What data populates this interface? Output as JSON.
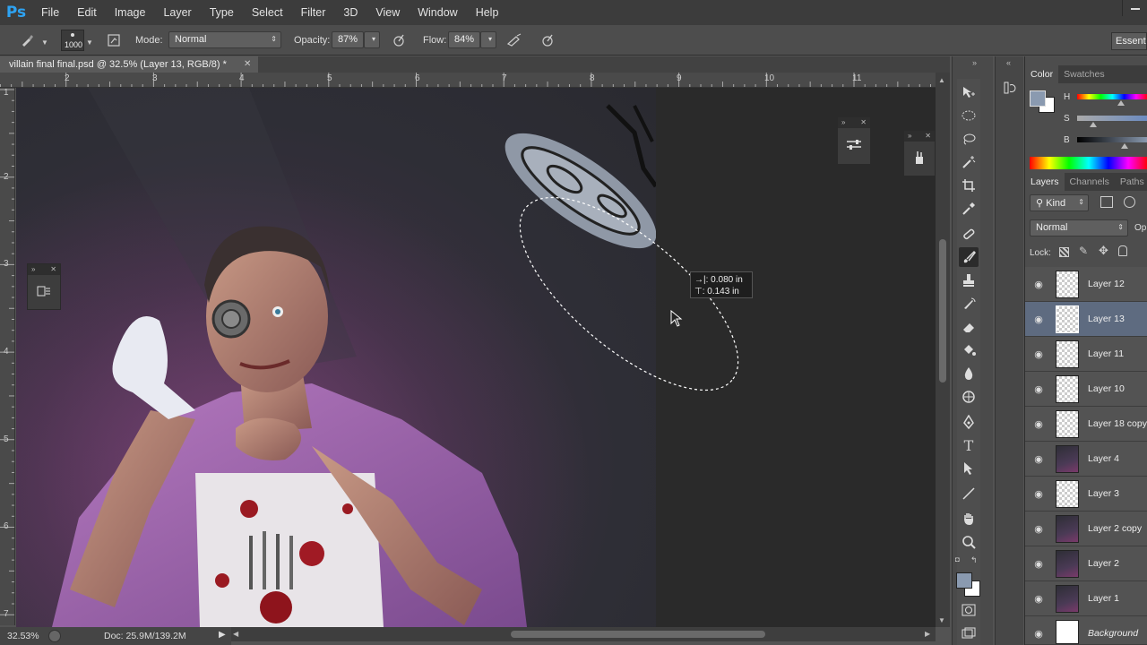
{
  "app": {
    "logo": "Ps",
    "window_minimize": "—"
  },
  "menu": [
    "File",
    "Edit",
    "Image",
    "Layer",
    "Type",
    "Select",
    "Filter",
    "3D",
    "View",
    "Window",
    "Help"
  ],
  "options": {
    "brush_size": "1000",
    "mode_label": "Mode:",
    "mode_value": "Normal",
    "opacity_label": "Opacity:",
    "opacity_value": "87%",
    "flow_label": "Flow:",
    "flow_value": "84%",
    "workspace": "Essentials"
  },
  "document": {
    "tab_title": "villain final final.psd @ 32.5% (Layer 13, RGB/8) *",
    "zoom": "32.53%",
    "doc_size": "Doc: 25.9M/139.2M"
  },
  "rulers": {
    "top": [
      "2",
      "3",
      "4",
      "5",
      "6",
      "7",
      "8",
      "9",
      "10",
      "11"
    ],
    "left": [
      "1",
      "2",
      "3",
      "4",
      "5",
      "6",
      "7"
    ]
  },
  "selection_info": {
    "width": "0.080 in",
    "height": "0.143 in"
  },
  "color_panel": {
    "tabs": [
      "Color",
      "Swatches"
    ],
    "active_tab": "Color",
    "sliders": [
      "H",
      "S",
      "B"
    ],
    "fg_color": "#8a9ab0",
    "bg_color": "#ffffff"
  },
  "layers_panel": {
    "tabs": [
      "Layers",
      "Channels",
      "Paths"
    ],
    "active_tab": "Layers",
    "filter_kind": "Kind",
    "blend_mode": "Normal",
    "opacity_abbr": "Op",
    "lock_label": "Lock:",
    "layers": [
      {
        "name": "Layer 12",
        "thumb": "transparent",
        "selected": false
      },
      {
        "name": "Layer 13",
        "thumb": "transparent",
        "selected": true
      },
      {
        "name": "Layer 11",
        "thumb": "transparent",
        "selected": false
      },
      {
        "name": "Layer 10",
        "thumb": "transparent",
        "selected": false
      },
      {
        "name": "Layer 18 copy",
        "thumb": "transparent",
        "selected": false
      },
      {
        "name": "Layer 4",
        "thumb": "paint",
        "selected": false
      },
      {
        "name": "Layer 3",
        "thumb": "transparent",
        "selected": false
      },
      {
        "name": "Layer 2 copy",
        "thumb": "paint",
        "selected": false
      },
      {
        "name": "Layer 2",
        "thumb": "paint",
        "selected": false
      },
      {
        "name": "Layer 1",
        "thumb": "paint",
        "selected": false
      },
      {
        "name": "Background",
        "thumb": "white",
        "selected": false
      }
    ]
  },
  "tools": [
    "move-tool",
    "elliptical-marquee-tool",
    "lasso-tool",
    "magic-wand-tool",
    "crop-tool",
    "eyedropper-tool",
    "spot-healing-tool",
    "brush-tool",
    "clone-stamp-tool",
    "history-brush-tool",
    "eraser-tool",
    "paint-bucket-tool",
    "blur-tool",
    "dodge-tool",
    "pen-tool",
    "type-tool",
    "path-selection-tool",
    "line-tool",
    "hand-tool",
    "zoom-tool"
  ],
  "active_tool": "brush-tool"
}
